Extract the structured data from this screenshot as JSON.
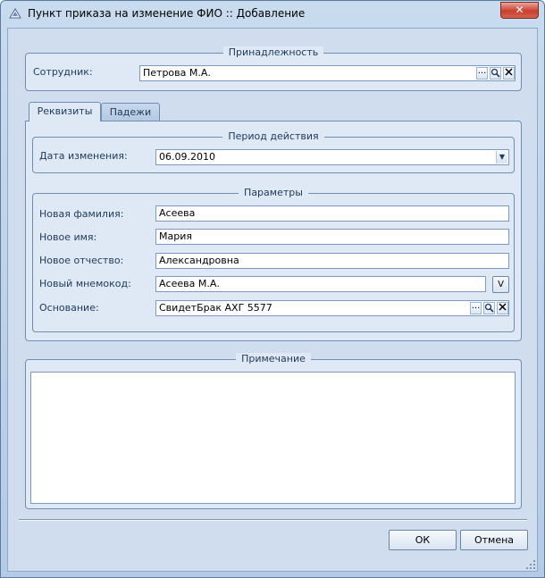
{
  "window": {
    "title": "Пункт приказа на изменение ФИО :: Добавление",
    "close_label": "✕"
  },
  "belonging": {
    "legend": "Принадлежность",
    "employee_label": "Сотрудник:",
    "employee_value": "Петрова М.А.",
    "btn_more": "···"
  },
  "tabs": [
    {
      "label": "Реквизиты"
    },
    {
      "label": "Падежи"
    }
  ],
  "period": {
    "legend": "Период действия",
    "date_label": "Дата изменения:",
    "date_value": "06.09.2010"
  },
  "params": {
    "legend": "Параметры",
    "surname_label": "Новая фамилия:",
    "surname_value": "Асеева",
    "name_label": "Новое имя:",
    "name_value": "Мария",
    "patronymic_label": "Новое отчество:",
    "patronymic_value": "Александровна",
    "mnemo_label": "Новый мнемокод:",
    "mnemo_value": "Асеева М.А.",
    "mnemo_button": "V",
    "basis_label": "Основание:",
    "basis_value": "СвидетБрак АХГ  5577"
  },
  "notes": {
    "legend": "Примечание",
    "value": ""
  },
  "buttons": {
    "ok": "ОК",
    "cancel": "Отмена"
  }
}
